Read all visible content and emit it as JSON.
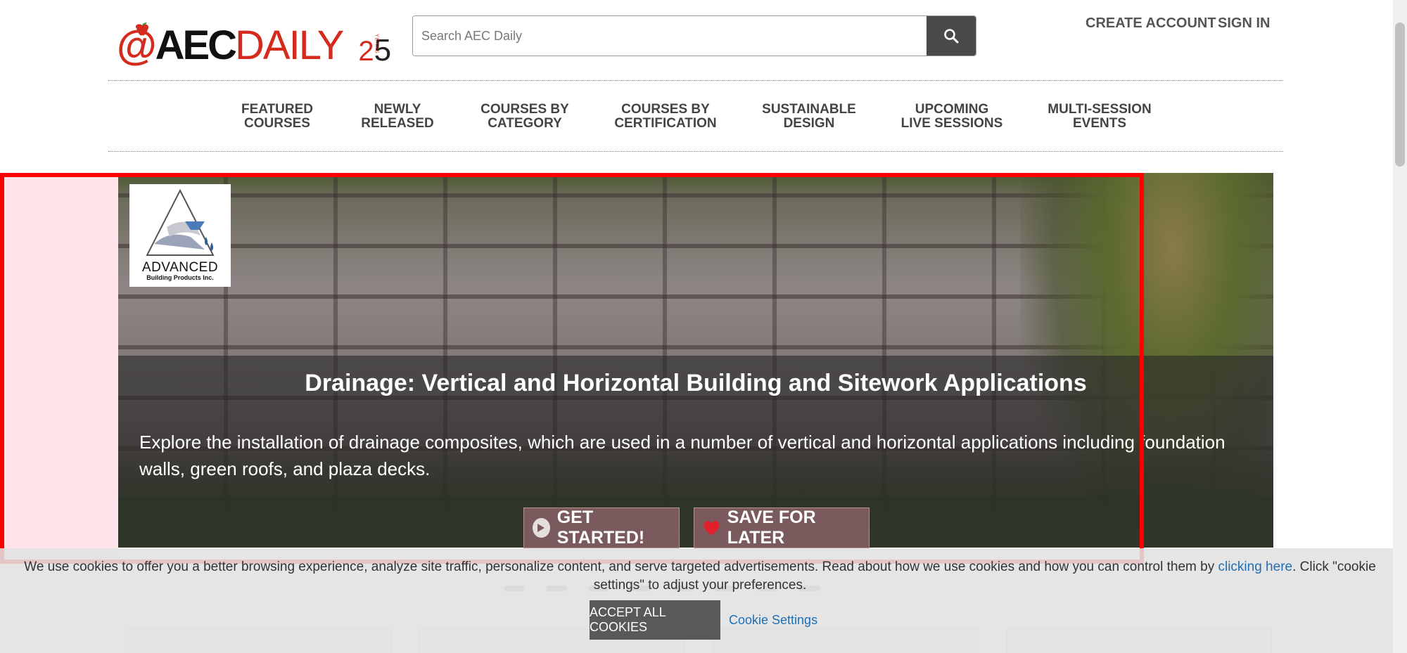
{
  "header": {
    "logo": {
      "at": "@",
      "aec": "AEC",
      "daily": "DAILY",
      "anniv_two": "2",
      "anniv_five": "5",
      "years": "YEARS"
    },
    "search": {
      "placeholder": "Search AEC Daily"
    },
    "links": {
      "create_account": "CREATE ACCOUNT",
      "sign_in": "SIGN IN"
    }
  },
  "nav": {
    "items": [
      {
        "line1": "FEATURED",
        "line2": "COURSES"
      },
      {
        "line1": "NEWLY",
        "line2": "RELEASED"
      },
      {
        "line1": "COURSES BY",
        "line2": "CATEGORY"
      },
      {
        "line1": "COURSES BY",
        "line2": "CERTIFICATION"
      },
      {
        "line1": "SUSTAINABLE",
        "line2": "DESIGN"
      },
      {
        "line1": "UPCOMING",
        "line2": "LIVE SESSIONS"
      },
      {
        "line1": "MULTI-SESSION",
        "line2": "EVENTS"
      }
    ]
  },
  "hero": {
    "sponsor": {
      "name": "ADVANCED",
      "sub": "Building Products Inc."
    },
    "title": "Drainage: Vertical and Horizontal Building and Sitework Applications",
    "description": "Explore the installation of drainage composites, which are used in a number of vertical and horizontal applications including foundation walls, green roofs, and plaza decks.",
    "buttons": {
      "get_started": "GET STARTED!",
      "save_for_later": "SAVE FOR LATER"
    }
  },
  "cookie": {
    "text_before": "We use cookies to offer you a better browsing experience, analyze site traffic, personalize content, and serve targeted advertisements. Read about how we use cookies and how you can control them by ",
    "link": "clicking here",
    "text_after": ". Click \"cookie settings\" to adjust your preferences.",
    "accept": "ACCEPT ALL COOKIES",
    "settings": "Cookie Settings"
  },
  "colors": {
    "brand_red": "#d52b1e",
    "highlight": "#ff0000",
    "link_blue": "#1f6fb3"
  }
}
